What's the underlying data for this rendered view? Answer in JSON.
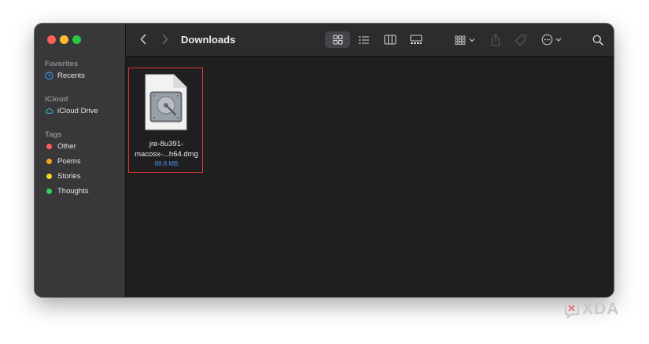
{
  "window": {
    "title": "Downloads"
  },
  "sidebar": {
    "sections": [
      {
        "title": "Favorites",
        "items": [
          {
            "label": "Recents",
            "icon": "clock-icon"
          }
        ]
      },
      {
        "title": "iCloud",
        "items": [
          {
            "label": "iCloud Drive",
            "icon": "cloud-icon"
          }
        ]
      },
      {
        "title": "Tags",
        "items": [
          {
            "label": "Other",
            "color": "#ff5c5c"
          },
          {
            "label": "Poems",
            "color": "#f7a21b"
          },
          {
            "label": "Stories",
            "color": "#f5d623"
          },
          {
            "label": "Thoughts",
            "color": "#2fd158"
          }
        ]
      }
    ]
  },
  "toolbar": {
    "icons": [
      "back-icon",
      "forward-icon",
      "icon-view-icon",
      "list-view-icon",
      "column-view-icon",
      "gallery-view-icon",
      "group-icon",
      "share-icon",
      "tag-icon",
      "more-icon",
      "search-icon"
    ]
  },
  "files": [
    {
      "name_line1": "jre-8u391-",
      "name_line2": "macosx-...h64.dmg",
      "size": "88.8 MB",
      "icon": "disk-image-icon"
    }
  ],
  "watermark": {
    "text": "XDA"
  },
  "colors": {
    "selection_border": "#d83a2d",
    "accent": "#4a8fe0"
  }
}
